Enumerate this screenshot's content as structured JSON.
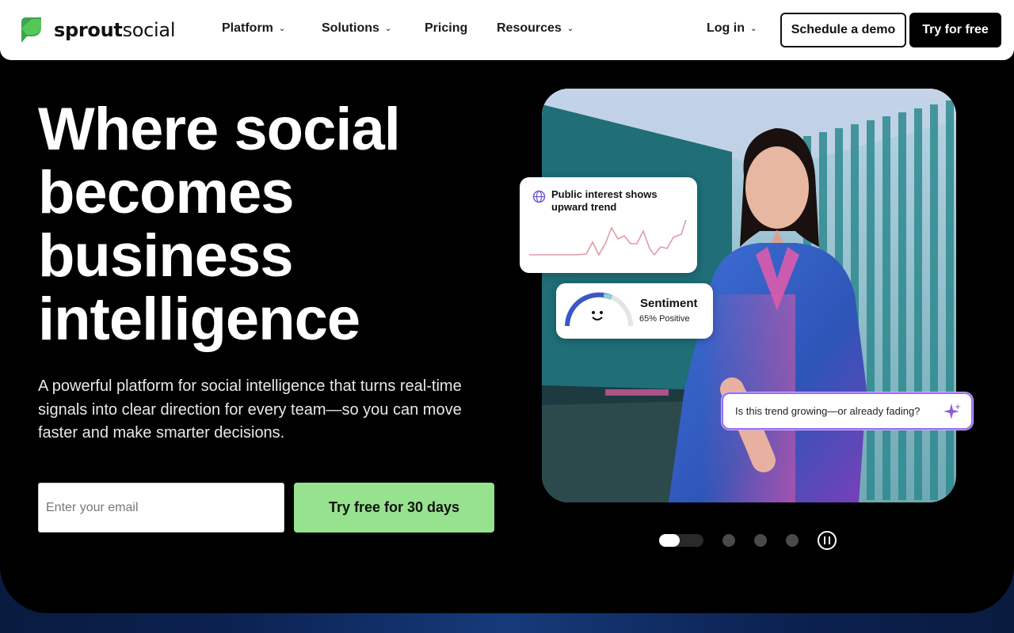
{
  "brand": {
    "name_bold": "sprout",
    "name_light": "social",
    "accent": "#59cb59",
    "cta_color": "#96e28e"
  },
  "nav": {
    "items": [
      {
        "label": "Platform",
        "has_menu": true
      },
      {
        "label": "Solutions",
        "has_menu": true
      },
      {
        "label": "Pricing",
        "has_menu": false
      },
      {
        "label": "Resources",
        "has_menu": true
      }
    ],
    "login": "Log in",
    "demo": "Schedule a demo",
    "try": "Try for free"
  },
  "hero": {
    "headline_lines": [
      "Where social",
      "becomes",
      "business",
      "intelligence"
    ],
    "subtitle": "A powerful platform for social intelligence that turns real-time signals into clear direction for every team—so you can move faster and make smarter decisions.",
    "email_placeholder": "Enter your email",
    "cta": "Try free for 30 days"
  },
  "cards": {
    "trend_title": "Public interest shows upward trend",
    "sentiment_title": "Sentiment",
    "sentiment_value": "65% Positive",
    "question": "Is this trend growing—or already fading?"
  },
  "carousel": {
    "slides": 4,
    "active": 1
  }
}
